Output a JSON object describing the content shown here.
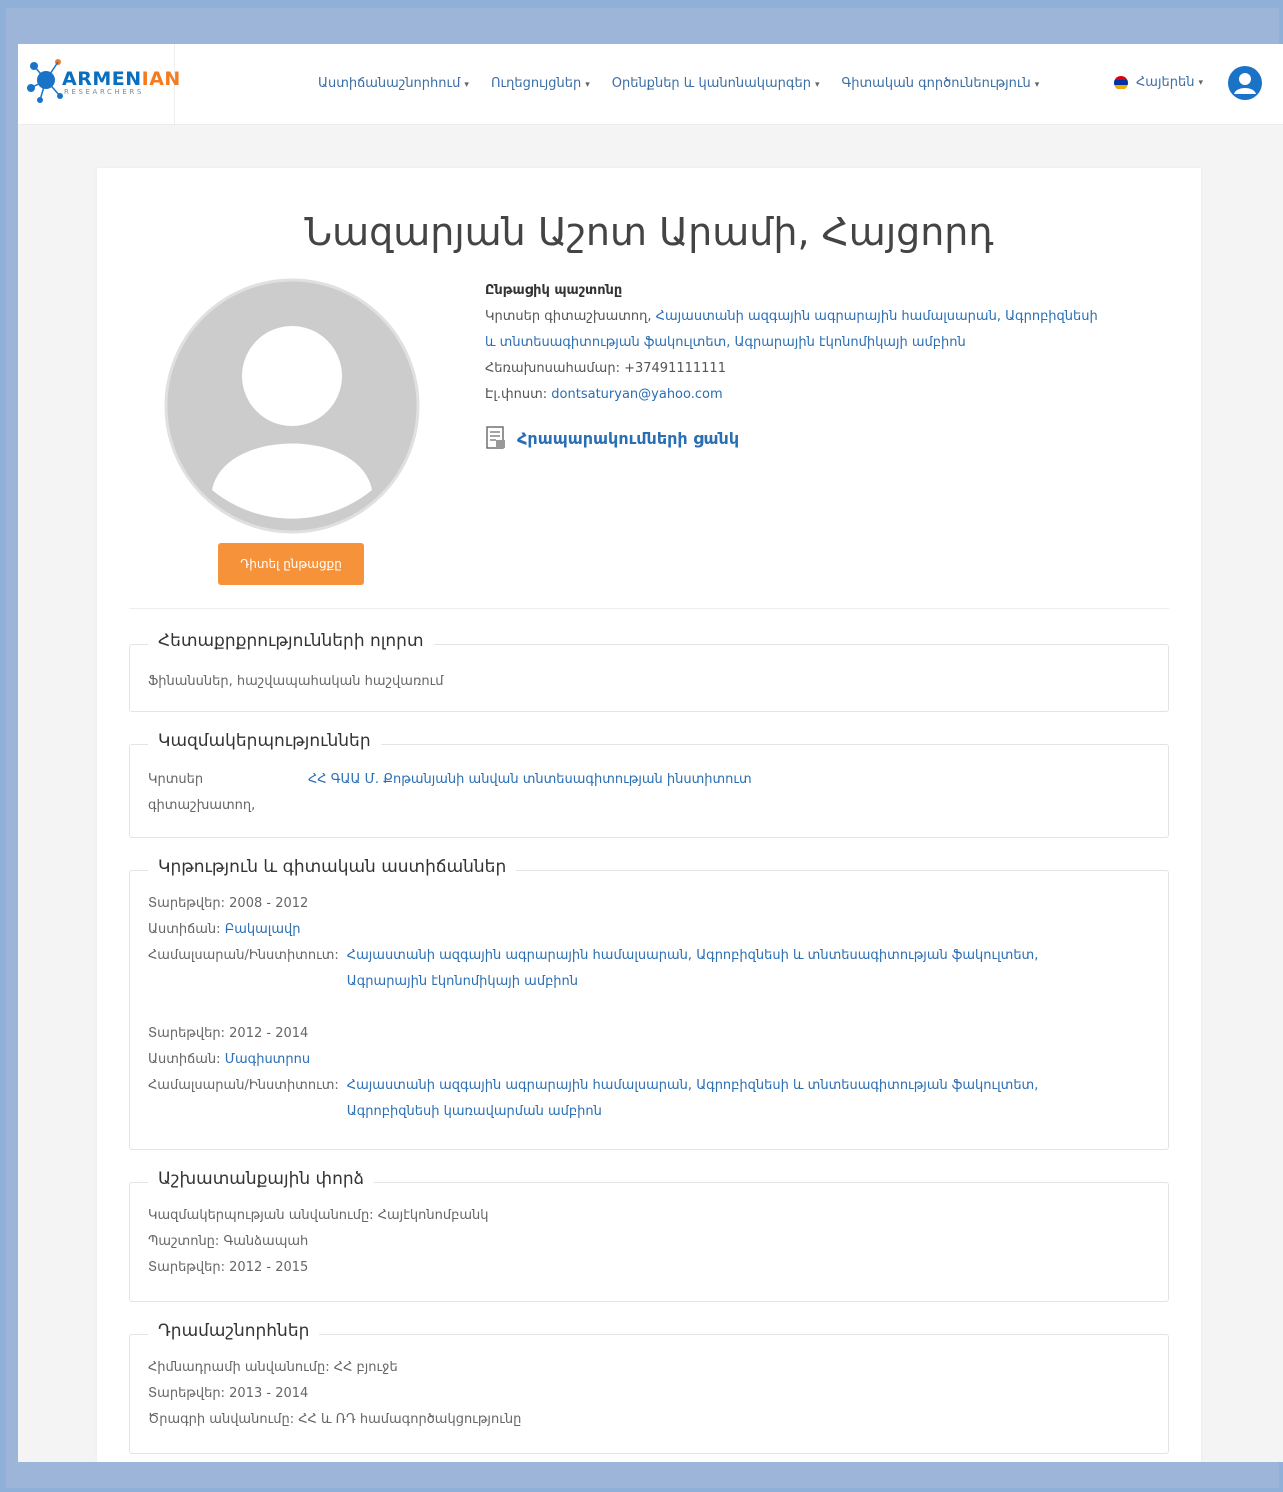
{
  "logo": {
    "main_a": "ARMEN",
    "main_b": "IAN",
    "sub": "RESEARCHERS"
  },
  "nav": {
    "items": [
      {
        "label": "Աստիճանաշնորհում"
      },
      {
        "label": "Ուղեցույցներ"
      },
      {
        "label": "Օրենքներ և կանոնակարգեր"
      },
      {
        "label": "Գիտական գործունեություն"
      }
    ],
    "language": "Հայերեն"
  },
  "profile": {
    "name": "Նազարյան Աշոտ Արամի, Հայցորդ",
    "view_button": "Դիտել ընթացքը",
    "current_position_label": "Ընթացիկ պաշտոնը",
    "position_text": "Կրտսեր գիտաշխատող,",
    "position_link_1": "Հայաստանի ազգային ագրարային համալսարան, Ագրոբիզնեսի",
    "position_link_2": "և տնտեսագիտության ֆակուլտետ, Ագրարային էկոնոմիկայի ամբիոն",
    "phone_label": "Հեռախոսահամար:",
    "phone": "+37491111111",
    "email_label": "Էլ.փոստ:",
    "email": "dontsaturyan@yahoo.com",
    "publications_label": "Հրապարակումների ցանկ"
  },
  "interests": {
    "title": "Հետաքրքրությունների ոլորտ",
    "text": "Ֆինանսներ, հաշվապահական հաշվառում"
  },
  "organizations": {
    "title": "Կազմակերպություններ",
    "role_1": "Կրտսեր",
    "role_2": "գիտաշխատող,",
    "org": "ՀՀ ԳԱԱ Մ. Քոթանյանի անվան տնտեսագիտության ինստիտուտ"
  },
  "education": {
    "title": "Կրթություն և գիտական աստիճաններ",
    "years_label": "Տարեթվեր:",
    "degree_label": "Աստիճան:",
    "institution_label": "Համալսարան/Ինստիտուտ:",
    "entries": [
      {
        "years": "2008 - 2012",
        "degree": "Բակալավր",
        "inst_1": "Հայաստանի ազգային ագրարային համալսարան, Ագրոբիզնեսի և տնտեսագիտության ֆակուլտետ,",
        "inst_2": "Ագրարային էկոնոմիկայի ամբիոն"
      },
      {
        "years": "2012 - 2014",
        "degree": "Մագիստրոս",
        "inst_1": "Հայաստանի ազգային ագրարային համալսարան, Ագրոբիզնեսի և տնտեսագիտության ֆակուլտետ,",
        "inst_2": "Ագրոբիզնեսի կառավարման ամբիոն"
      }
    ]
  },
  "work": {
    "title": "Աշխատանքային փորձ",
    "org_label": "Կազմակերպության անվանումը:",
    "org": "Հայէկոնոմբանկ",
    "position_label": "Պաշտոնը:",
    "position": "Գանձապահ",
    "years_label": "Տարեթվեր:",
    "years": "2012 - 2015"
  },
  "grants": {
    "title": "Դրամաշնորհներ",
    "fund_label": "Հիմնադրամի անվանումը:",
    "fund": "ՀՀ բյուջե",
    "years_label": "Տարեթվեր:",
    "years": "2013 - 2014",
    "program_label": "Ծրագրի անվանումը:",
    "program": "ՀՀ և ՌԴ համագործակցությունը"
  }
}
